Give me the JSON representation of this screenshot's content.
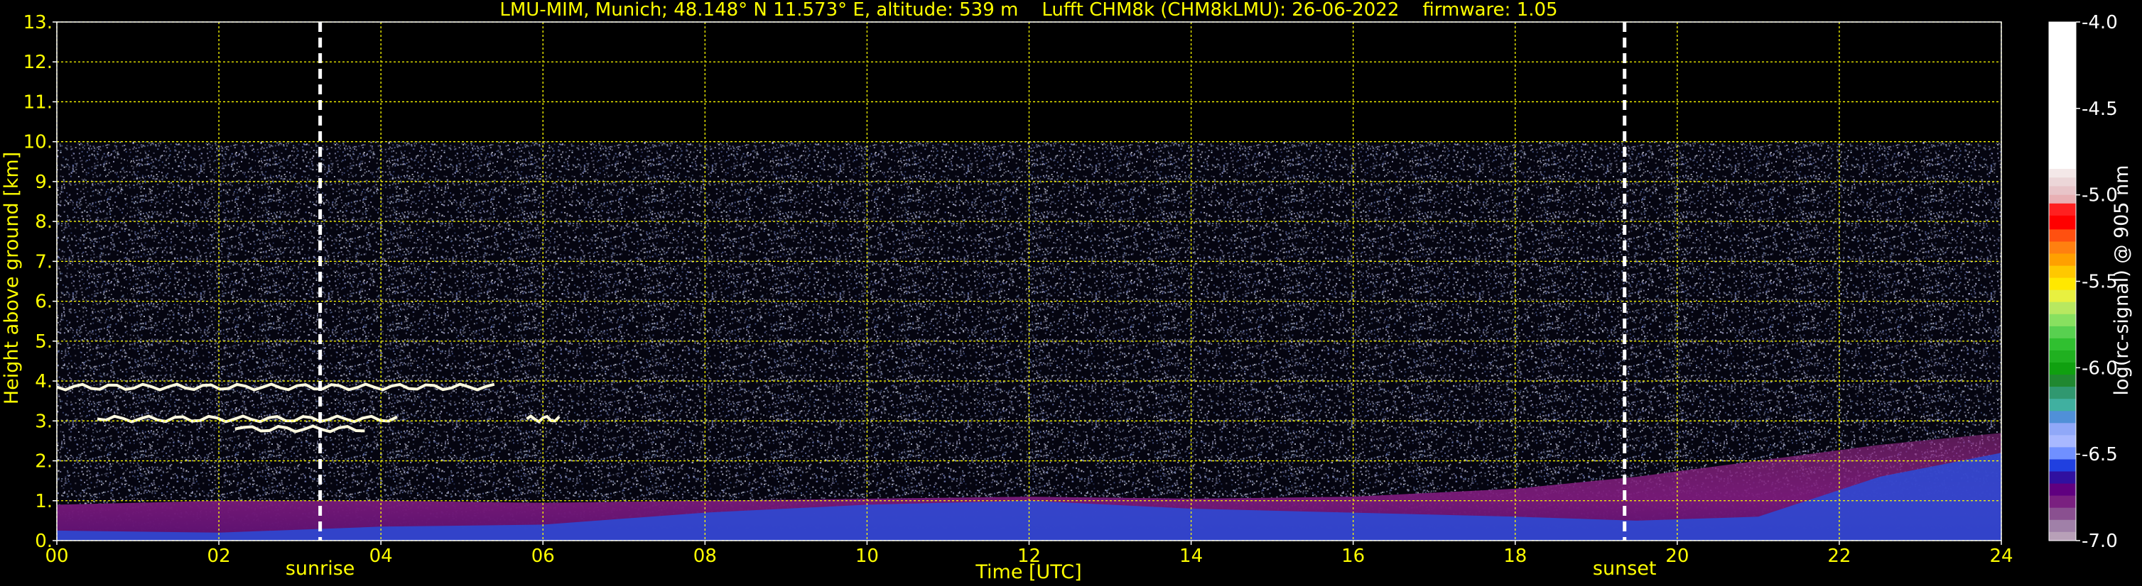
{
  "title": "LMU-MIM, Munich; 48.148° N 11.573° E, altitude: 539 m    Lufft CHM8k (CHM8kLMU): 26-06-2022    firmware: 1.05",
  "chart_data": {
    "type": "heatmap",
    "title": "LMU-MIM, Munich; 48.148° N 11.573° E, altitude: 539 m    Lufft CHM8k (CHM8kLMU): 26-06-2022    firmware: 1.05",
    "xlabel": "Time [UTC]",
    "ylabel": "Height above ground [km]",
    "xlim": [
      0,
      24
    ],
    "ylim": [
      0,
      13
    ],
    "x_ticks": [
      "00",
      "02",
      "04",
      "06",
      "08",
      "10",
      "12",
      "14",
      "16",
      "18",
      "20",
      "22",
      "24"
    ],
    "y_ticks": [
      "0.",
      "1.",
      "2.",
      "3.",
      "4.",
      "5.",
      "6.",
      "7.",
      "8.",
      "9.",
      "10.",
      "11.",
      "12.",
      "13."
    ],
    "grid": true,
    "markers": [
      {
        "label": "sunrise",
        "x": 3.25
      },
      {
        "label": "sunset",
        "x": 19.35
      }
    ],
    "colorbar": {
      "label": "log(rc-signal) @ 905 nm",
      "ticks": [
        "-4.0",
        "-4.5",
        "-5.0",
        "-5.5",
        "-6.0",
        "-6.5",
        "-7.0"
      ],
      "range": [
        -7.0,
        -4.0
      ]
    },
    "data_ceiling_km": 10.0,
    "features": {
      "boundary_layer": [
        {
          "t": 0,
          "top": 0.9,
          "blue_top": 0.25
        },
        {
          "t": 2,
          "top": 1.0,
          "blue_top": 0.2
        },
        {
          "t": 4,
          "top": 1.0,
          "blue_top": 0.35
        },
        {
          "t": 6,
          "top": 0.95,
          "blue_top": 0.4
        },
        {
          "t": 8,
          "top": 1.0,
          "blue_top": 0.7
        },
        {
          "t": 10,
          "top": 1.05,
          "blue_top": 0.9
        },
        {
          "t": 12,
          "top": 1.1,
          "blue_top": 1.0
        },
        {
          "t": 14,
          "top": 1.05,
          "blue_top": 0.8
        },
        {
          "t": 16,
          "top": 1.1,
          "blue_top": 0.7
        },
        {
          "t": 18,
          "top": 1.3,
          "blue_top": 0.6
        },
        {
          "t": 19.5,
          "top": 1.6,
          "blue_top": 0.5
        },
        {
          "t": 21,
          "top": 2.0,
          "blue_top": 0.6
        },
        {
          "t": 22.5,
          "top": 2.4,
          "blue_top": 1.6
        },
        {
          "t": 24,
          "top": 2.7,
          "blue_top": 2.2
        }
      ],
      "cloud_layers": [
        {
          "t_start": 0.0,
          "t_end": 5.4,
          "height": 3.85
        },
        {
          "t_start": 0.5,
          "t_end": 4.2,
          "height": 3.05
        },
        {
          "t_start": 2.2,
          "t_end": 3.8,
          "height": 2.8
        },
        {
          "t_start": 5.8,
          "t_end": 6.2,
          "height": 3.05
        }
      ]
    }
  },
  "colors": {
    "axis_text": "#ffff00",
    "grid": "#ffff00",
    "marker": "#ffffff",
    "background": "#000000"
  }
}
